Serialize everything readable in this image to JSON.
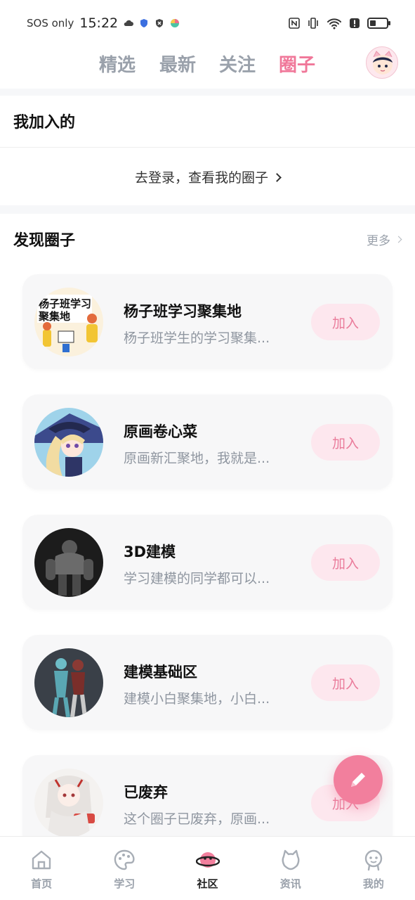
{
  "status_bar": {
    "carrier": "SOS only",
    "time": "15:22",
    "battery_level_percent": 35,
    "icons": [
      "cloud-icon",
      "shield-icon",
      "close-badge-icon",
      "app-logo-icon",
      "nfc-icon",
      "vibrate-icon",
      "wifi-icon",
      "alert-icon",
      "battery-icon"
    ]
  },
  "top_tabs": [
    {
      "label": "精选",
      "active": false
    },
    {
      "label": "最新",
      "active": false
    },
    {
      "label": "关注",
      "active": false
    },
    {
      "label": "圈子",
      "active": true
    }
  ],
  "joined_section": {
    "title": "我加入的",
    "login_prompt": "去登录，查看我的圈子"
  },
  "discover_section": {
    "title": "发现圈子",
    "more_label": "更多"
  },
  "circles": [
    {
      "name": "杨子班学习聚集地",
      "desc": "杨子班学生的学习聚集...",
      "join_label": "加入",
      "thumb_text": "杨子班学习\n聚集地"
    },
    {
      "name": "原画卷心菜",
      "desc": "原画新汇聚地，我就是...",
      "join_label": "加入"
    },
    {
      "name": "3D建模",
      "desc": "学习建模的同学都可以...",
      "join_label": "加入"
    },
    {
      "name": "建模基础区",
      "desc": "建模小白聚集地，小白...",
      "join_label": "加入"
    },
    {
      "name": "已废弃",
      "desc": "这个圈子已废弃，原画...",
      "join_label": "加入"
    }
  ],
  "bottom_nav": [
    {
      "label": "首页",
      "icon": "home-icon",
      "active": false
    },
    {
      "label": "学习",
      "icon": "palette-icon",
      "active": false
    },
    {
      "label": "社区",
      "icon": "planet-icon",
      "active": true
    },
    {
      "label": "资讯",
      "icon": "cat-icon",
      "active": false
    },
    {
      "label": "我的",
      "icon": "smiley-icon",
      "active": false
    }
  ],
  "colors": {
    "accent": "#f07799",
    "join_bg": "#fde7ee",
    "muted": "#9aa1ab"
  }
}
